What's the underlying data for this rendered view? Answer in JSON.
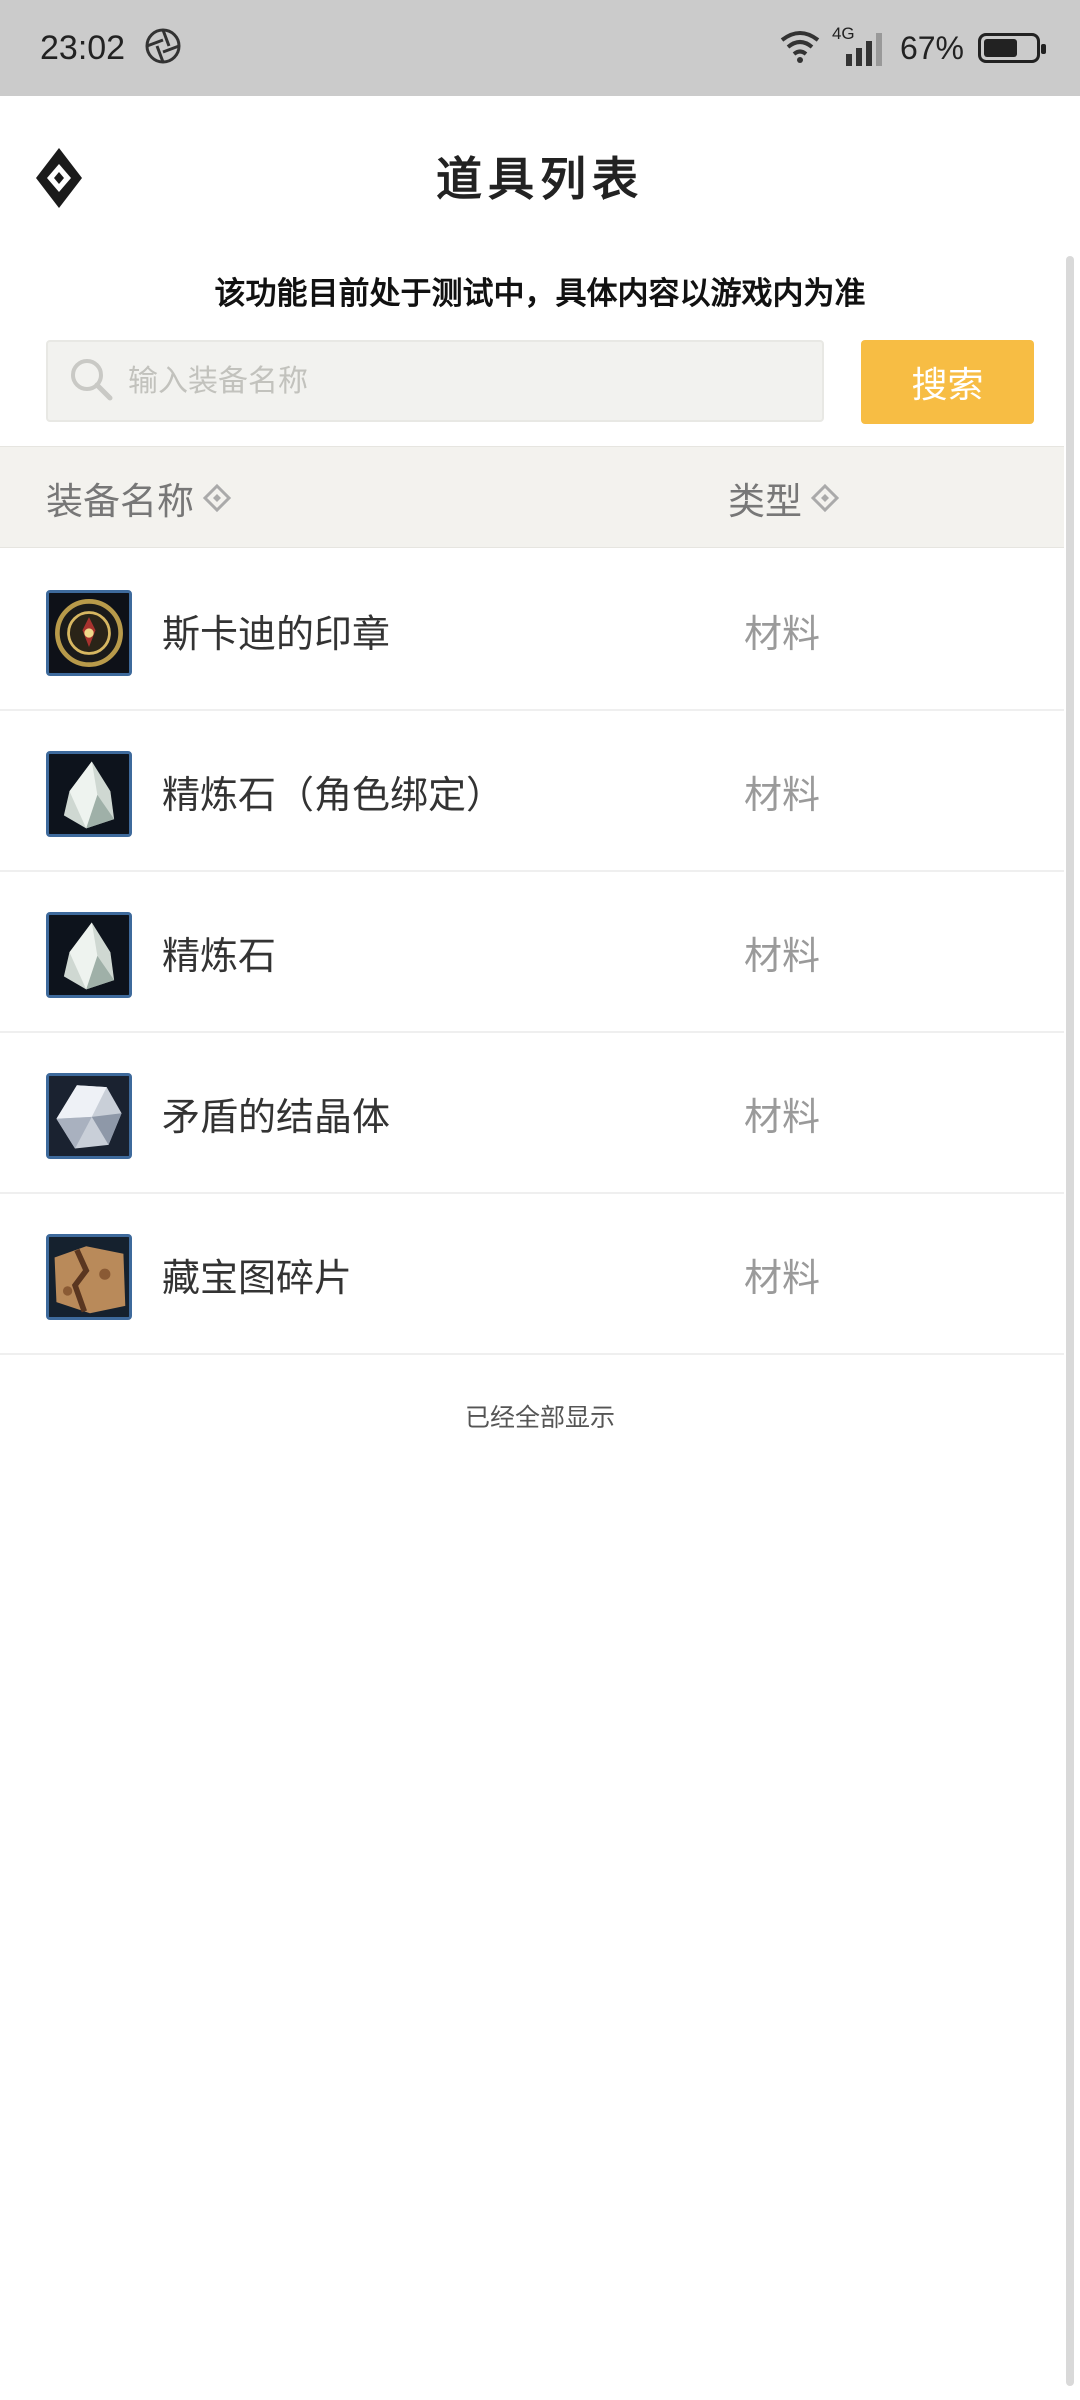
{
  "status_bar": {
    "time": "23:02",
    "network": "4G",
    "battery_percent": "67%",
    "battery_level": 0.67
  },
  "header": {
    "title": "道具列表",
    "logo_icon": "diamond-logo-icon"
  },
  "notice": "该功能目前处于测试中，具体内容以游戏内为准",
  "search": {
    "placeholder": "输入装备名称",
    "button_label": "搜索"
  },
  "table": {
    "columns": {
      "name": "装备名称",
      "type": "类型"
    },
    "rows": [
      {
        "name": "斯卡迪的印章",
        "type": "材料",
        "icon": "seal-icon"
      },
      {
        "name": "精炼石（角色绑定）",
        "type": "材料",
        "icon": "refine-stone-icon"
      },
      {
        "name": "精炼石",
        "type": "材料",
        "icon": "refine-stone-icon"
      },
      {
        "name": "矛盾的结晶体",
        "type": "材料",
        "icon": "crystal-icon"
      },
      {
        "name": "藏宝图碎片",
        "type": "材料",
        "icon": "treasure-map-fragment-icon"
      }
    ]
  },
  "footer": "已经全部显示",
  "colors": {
    "accent": "#f7bd44",
    "status_bar": "#cbcbcb",
    "table_header_bg": "#f3f2ee",
    "icon_border": "#3e6a9c"
  }
}
